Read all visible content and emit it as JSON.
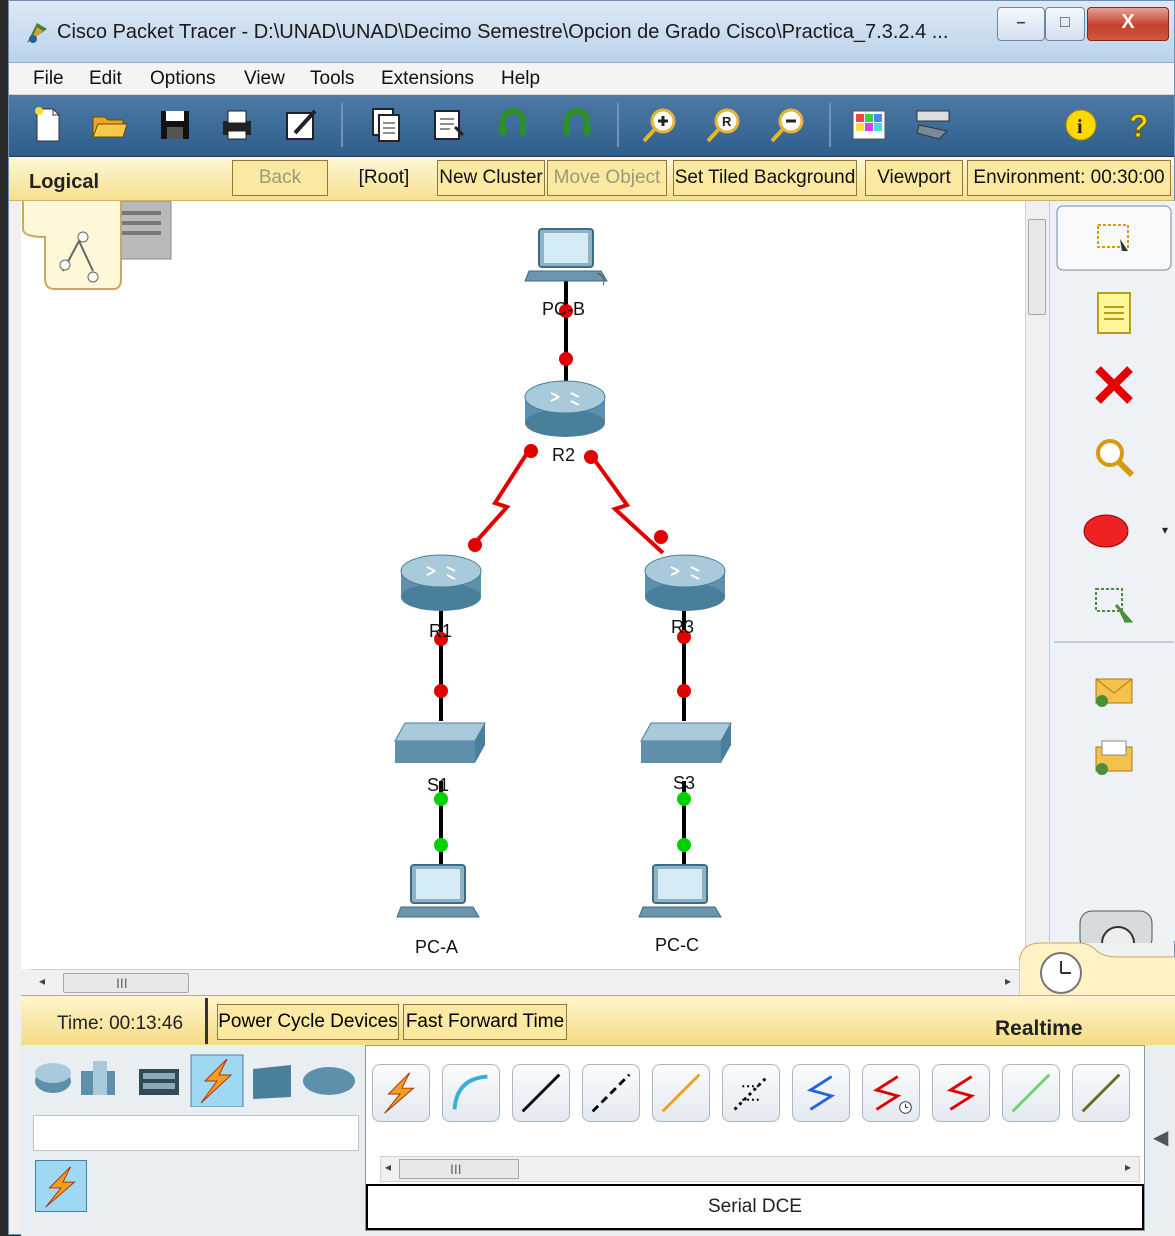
{
  "window": {
    "title": "Cisco Packet Tracer - D:\\UNAD\\UNAD\\Decimo Semestre\\Opcion de Grado Cisco\\Practica_7.3.2.4 ...",
    "minimize_glyph": "–",
    "maximize_glyph": "□",
    "close_glyph": "X"
  },
  "menu": {
    "items": [
      "File",
      "Edit",
      "Options",
      "View",
      "Tools",
      "Extensions",
      "Help"
    ]
  },
  "logical_bar": {
    "label": "Logical",
    "back": "Back",
    "root": "[Root]",
    "new_cluster": "New Cluster",
    "move_object": "Move Object",
    "set_tiled_background": "Set Tiled Background",
    "viewport": "Viewport",
    "environment": "Environment: 00:30:00"
  },
  "topology": {
    "devices": [
      "PC-B",
      "R2",
      "R1",
      "R3",
      "S1",
      "S3",
      "PC-A",
      "PC-C"
    ],
    "link_up_color": "#00d000",
    "link_down_color": "#e00000",
    "serial_color": "#e00000"
  },
  "hscroll_glyph": "III",
  "time_bar": {
    "time": "Time: 00:13:46",
    "power_cycle": "Power Cycle Devices",
    "fast_forward": "Fast Forward Time",
    "mode": "Realtime"
  },
  "bottom": {
    "selected_connection": "Serial DCE",
    "hscroll_glyph": "III"
  }
}
